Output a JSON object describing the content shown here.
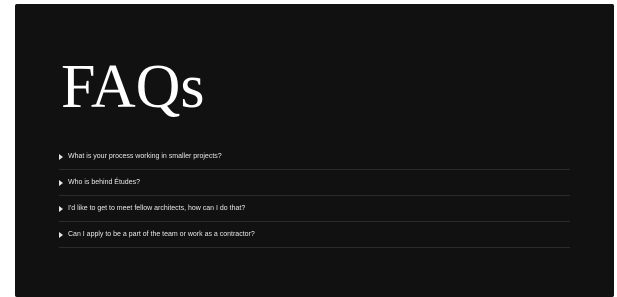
{
  "page": {
    "title": "FAQs"
  },
  "faq": {
    "items": [
      {
        "question": "What is your process working in smaller projects?",
        "icon": "triangle-right-icon"
      },
      {
        "question": "Who is behind Études?",
        "icon": "triangle-right-icon"
      },
      {
        "question": "I'd like to get to meet fellow architects, how can I do that?",
        "icon": "triangle-right-icon"
      },
      {
        "question": "Can I apply to be a part of the team or work as a contractor?",
        "icon": "triangle-right-icon"
      }
    ]
  },
  "colors": {
    "background": "#111111",
    "text": "#ffffff",
    "divider": "#2b2b2b"
  }
}
